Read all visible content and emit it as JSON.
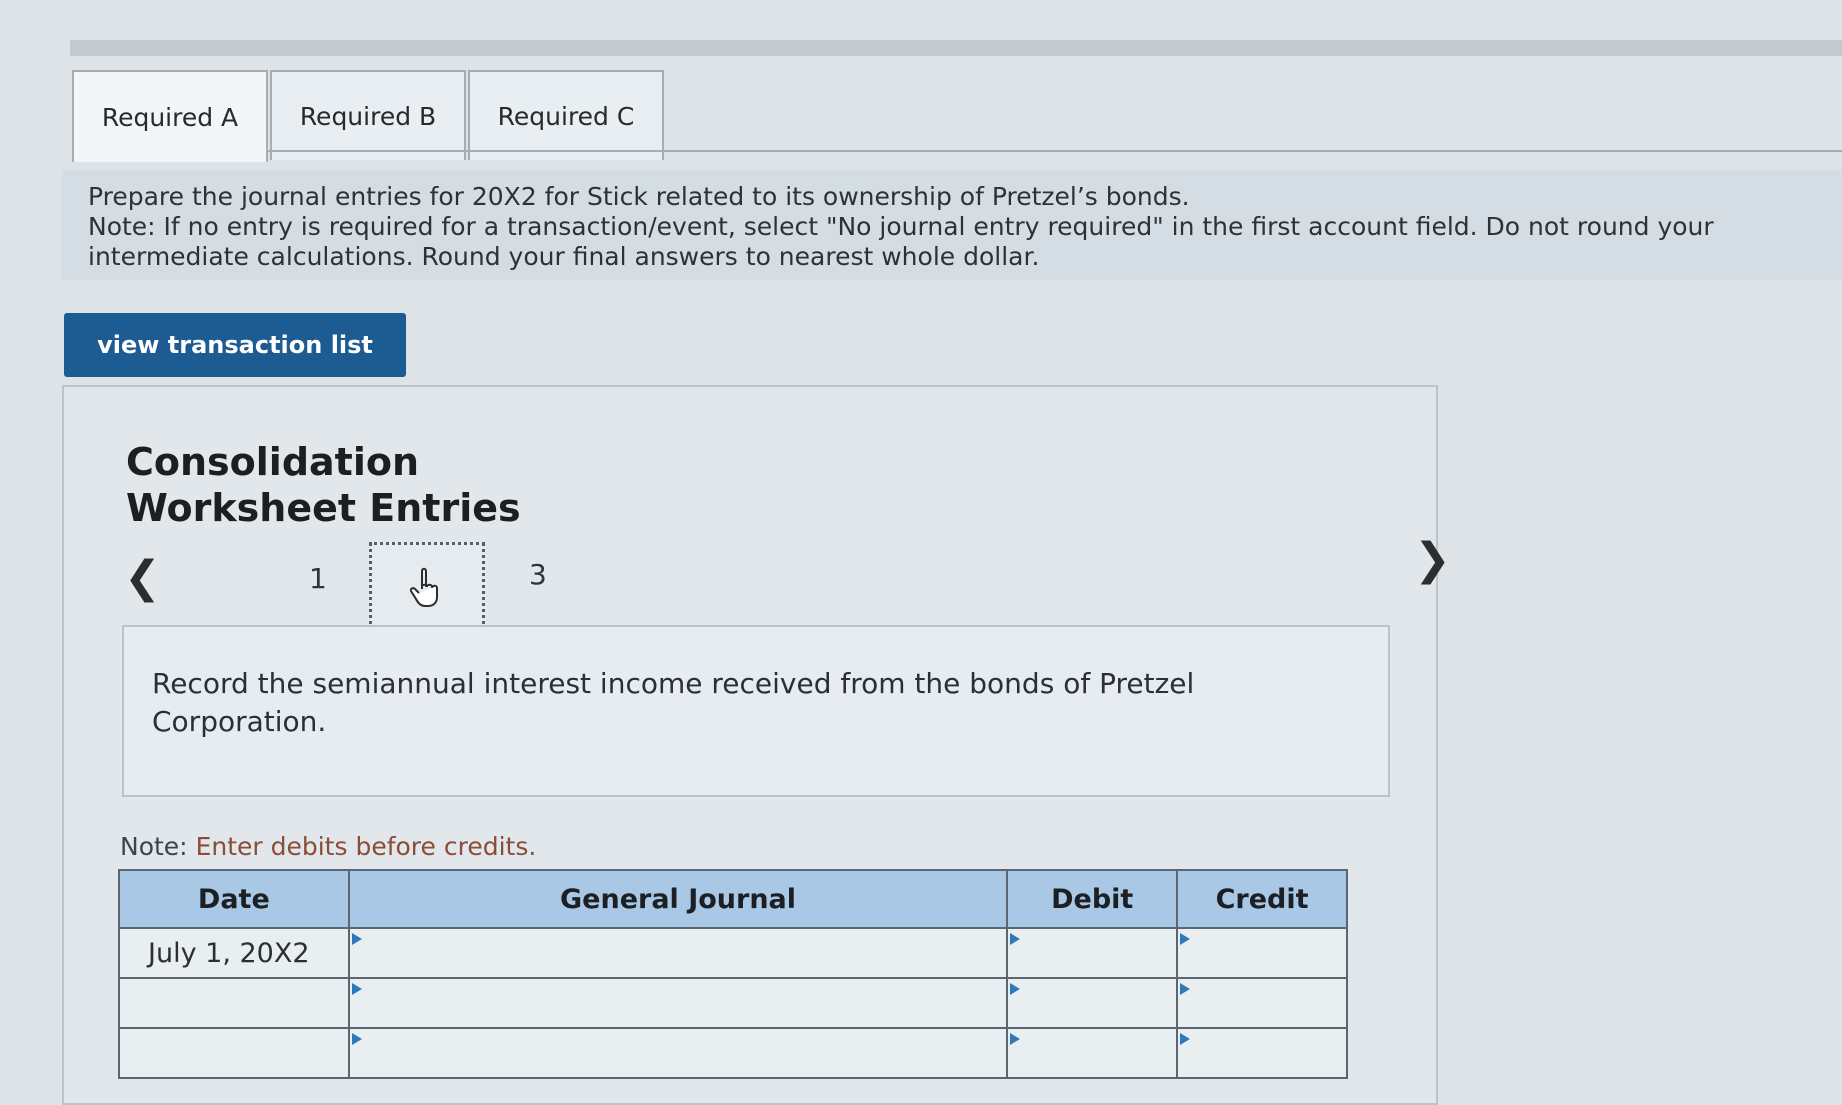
{
  "tabs": [
    {
      "label": "Required A",
      "active": true
    },
    {
      "label": "Required B",
      "active": false
    },
    {
      "label": "Required C",
      "active": false
    }
  ],
  "instructions": {
    "line1": "Prepare the journal entries for 20X2 for Stick related to its ownership of Pretzel’s bonds.",
    "line2": "Note: If no entry is required for a transaction/event, select \"No journal entry required\" in the first account field. Do not round your intermediate calculations. Round your final answers to nearest whole dollar."
  },
  "view_button_label": "view transaction list",
  "panel": {
    "title": "Consolidation Worksheet Entries",
    "pager": {
      "prev_icon": "chevron-left-icon",
      "next_icon": "chevron-right-icon",
      "pages": [
        "1",
        "2",
        "3"
      ],
      "current_page": 2,
      "cursor_icon": "hand-cursor-icon"
    },
    "description": "Record the semiannual interest income received from the bonds of Pretzel Corporation.",
    "note_prefix": "Note:",
    "note_text": "Enter debits before credits."
  },
  "journal": {
    "headers": {
      "date": "Date",
      "account": "General Journal",
      "debit": "Debit",
      "credit": "Credit"
    },
    "rows": [
      {
        "date": "July 1, 20X2",
        "account": "",
        "debit": "",
        "credit": ""
      },
      {
        "date": "",
        "account": "",
        "debit": "",
        "credit": ""
      },
      {
        "date": "",
        "account": "",
        "debit": "",
        "credit": ""
      }
    ]
  },
  "colors": {
    "accent": "#1c5c93",
    "header_bg": "#a8c8e5",
    "note_hint": "#8a4e37"
  }
}
